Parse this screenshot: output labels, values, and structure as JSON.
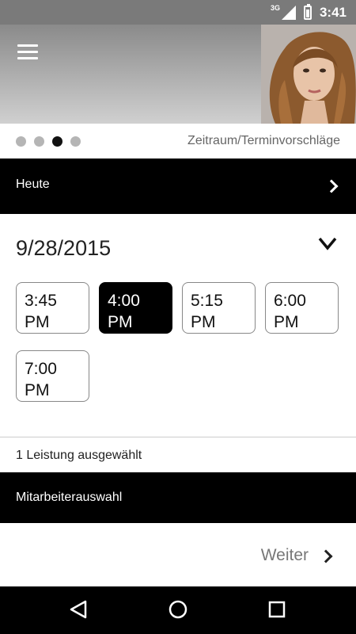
{
  "status_bar": {
    "network": "3G",
    "time": "3:41"
  },
  "header": {
    "menu_icon": "hamburger-menu-icon",
    "hero_image": "woman-portrait-photo"
  },
  "stepper": {
    "steps": 4,
    "active_step": 3,
    "label": "Zeitraum/Terminvorschläge"
  },
  "today_bar": {
    "label": "Heute"
  },
  "date_picker": {
    "date": "9/28/2015"
  },
  "time_slots": [
    {
      "line1": "3:45",
      "line2": "PM",
      "selected": false
    },
    {
      "line1": "4:00",
      "line2": "PM",
      "selected": true
    },
    {
      "line1": "5:15",
      "line2": "PM",
      "selected": false
    },
    {
      "line1": "6:00",
      "line2": "PM",
      "selected": false
    },
    {
      "line1": "7:00",
      "line2": "PM",
      "selected": false
    }
  ],
  "services": {
    "text": "1 Leistung ausgewählt"
  },
  "staff_bar": {
    "label": "Mitarbeiterauswahl"
  },
  "next": {
    "label": "Weiter"
  },
  "colors": {
    "accent": "#000000",
    "header_gray": "#8a8a8a",
    "muted_text": "#777777"
  },
  "nav_bar": {
    "back_icon": "back-triangle-icon",
    "home_icon": "home-circle-icon",
    "recents_icon": "recents-square-icon"
  }
}
